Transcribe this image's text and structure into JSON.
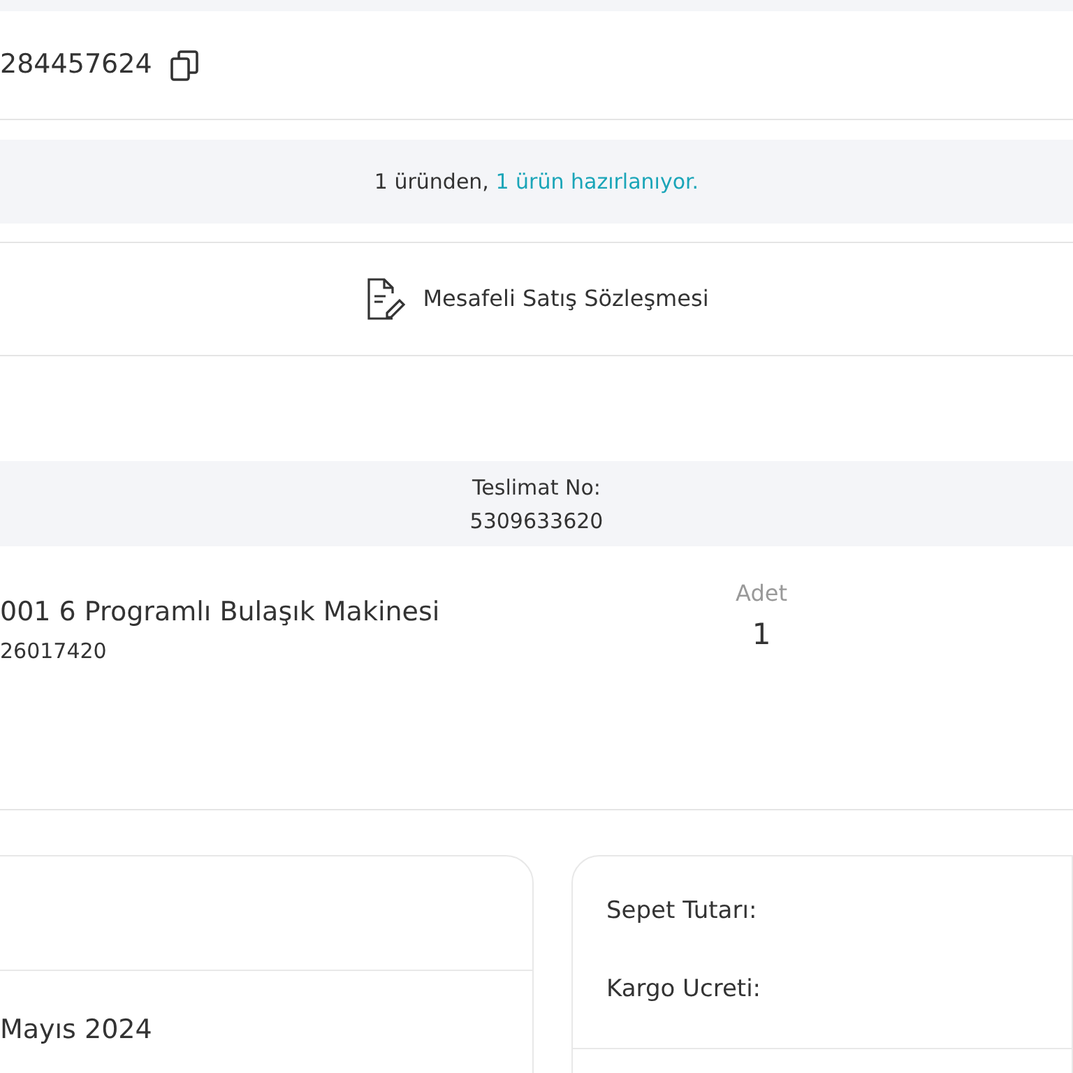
{
  "order": {
    "number": "284457624"
  },
  "status": {
    "text": "1 üründen,",
    "highlight": "1 ürün hazırlanıyor."
  },
  "contract": {
    "label": "Mesafeli Satış Sözleşmesi"
  },
  "delivery": {
    "label": "Teslimat No:",
    "number": "5309633620"
  },
  "product": {
    "name": "001 6 Programlı Bulaşık Makinesi",
    "code": "26017420",
    "quantity_label": "Adet",
    "quantity": "1"
  },
  "order_card": {
    "date": "Mayıs 2024"
  },
  "summary_card": {
    "rows": [
      "Sepet Tutarı:",
      "Kargo Ucreti:"
    ]
  }
}
